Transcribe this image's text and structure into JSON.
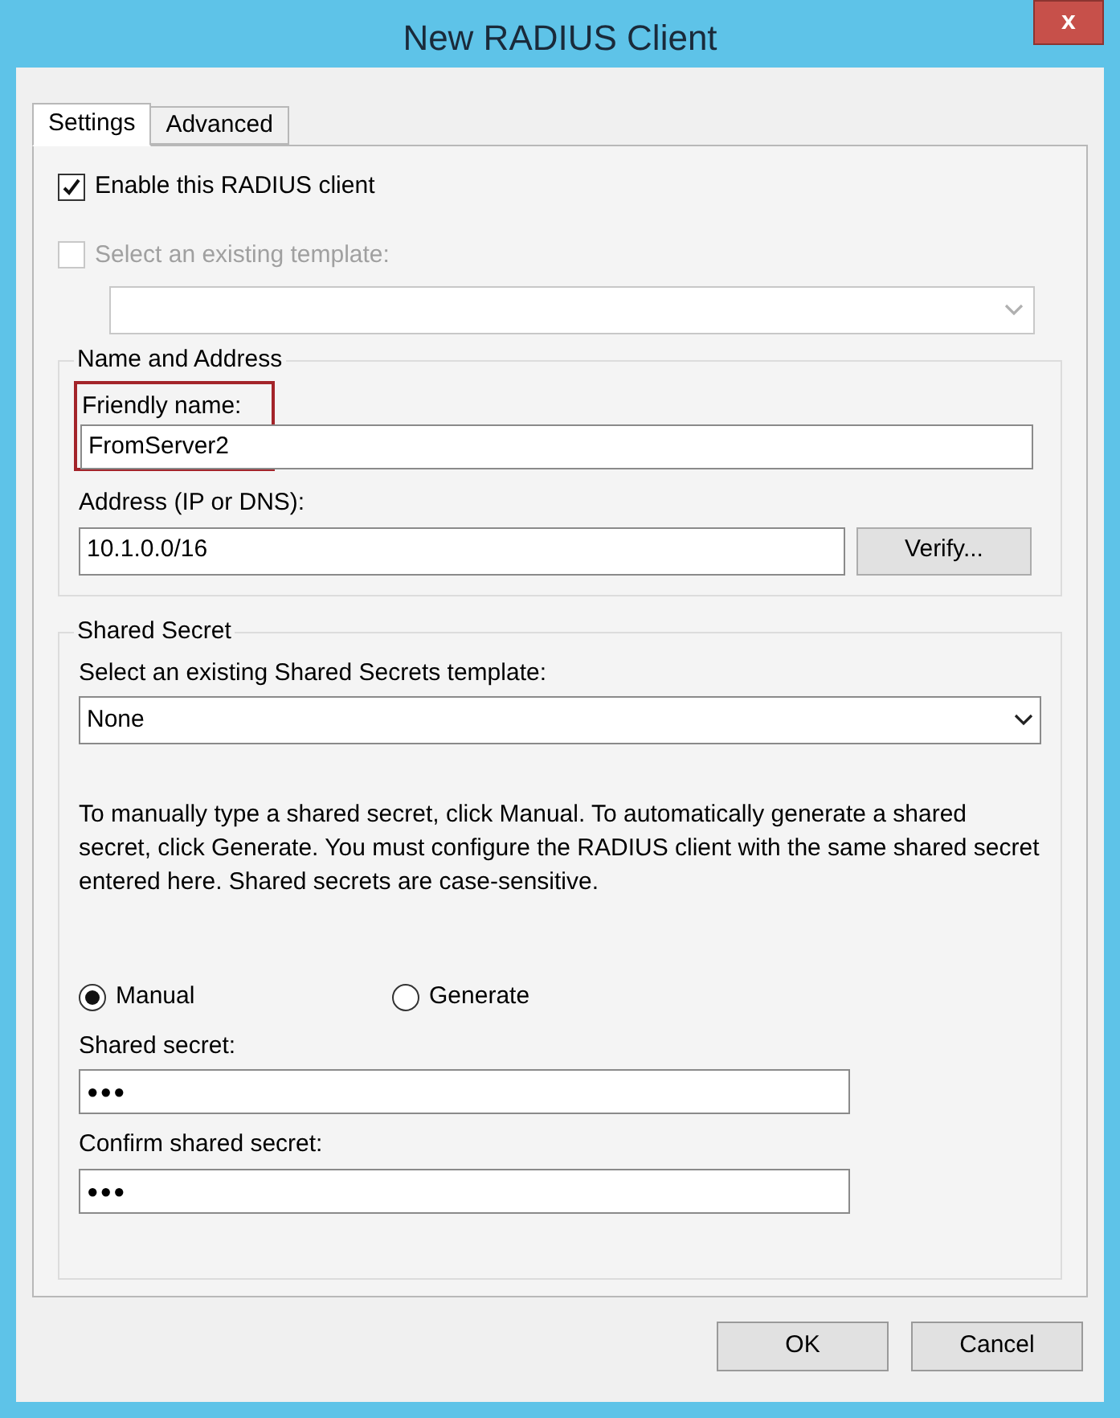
{
  "window": {
    "title": "New RADIUS Client",
    "close": "x"
  },
  "tabs": [
    {
      "label": "Settings",
      "selected": true
    },
    {
      "label": "Advanced",
      "selected": false
    }
  ],
  "enable_client": {
    "label": "Enable this RADIUS client",
    "checked": true,
    "disabled": false
  },
  "use_template": {
    "label": "Select an existing template:",
    "checked": false,
    "disabled": true
  },
  "template_dropdown": {
    "disabled": true
  },
  "name_and_address": {
    "title": "Name and Address",
    "friendly_name": {
      "label": "Friendly name:",
      "value": "FromServer2",
      "highlighted": true
    },
    "address": {
      "label": "Address (IP or DNS):",
      "value": "10.1.0.0/16"
    },
    "verify_button": "Verify..."
  },
  "shared_secret": {
    "title": "Shared Secret",
    "template_label": "Select an existing Shared Secrets template:",
    "template_value": "None",
    "description": "To manually type a shared secret, click Manual. To automatically generate a shared secret, click Generate. You must configure the RADIUS client with the same shared secret entered here. Shared secrets are case-sensitive.",
    "modes": [
      {
        "label": "Manual",
        "selected": true
      },
      {
        "label": "Generate",
        "selected": false
      }
    ],
    "secret": {
      "label": "Shared secret:",
      "value": "●●●"
    },
    "confirm": {
      "label": "Confirm shared secret:",
      "value": "●●●"
    }
  },
  "buttons": [
    "OK",
    "Cancel"
  ]
}
